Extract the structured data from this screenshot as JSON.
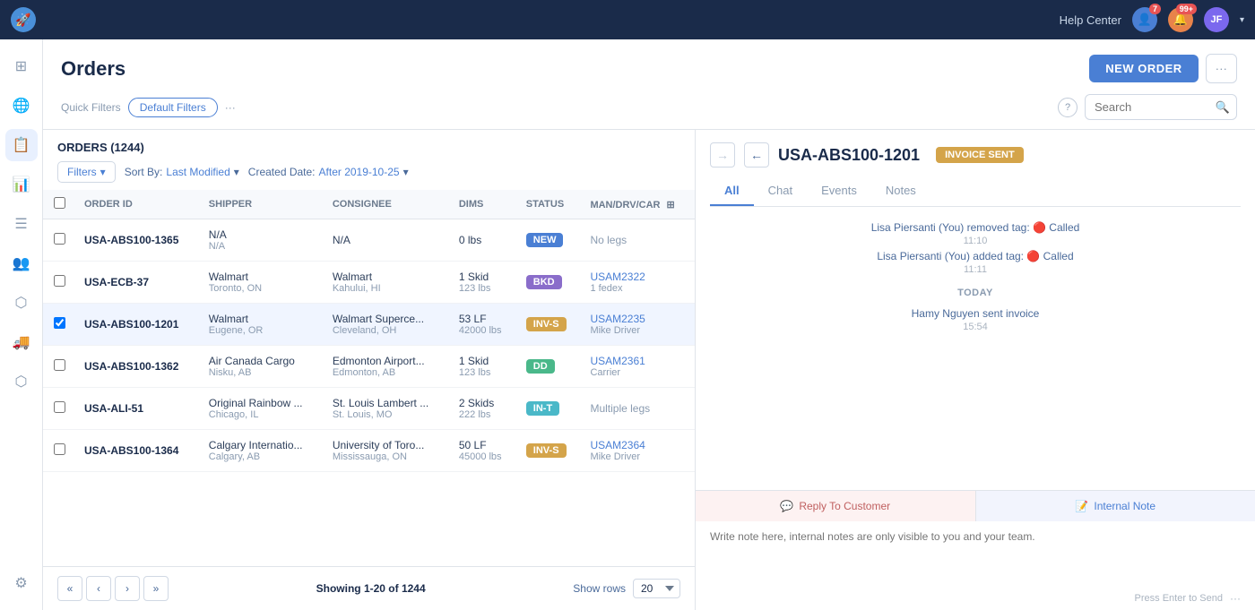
{
  "topNav": {
    "logoIcon": "🚀",
    "helpCenter": "Help Center",
    "notificationBadge1": "7",
    "notificationBadge2": "99+",
    "avatarText": "JF"
  },
  "sidebar": {
    "icons": [
      {
        "name": "home-icon",
        "symbol": "⊞",
        "active": false
      },
      {
        "name": "globe-icon",
        "symbol": "🌐",
        "active": false
      },
      {
        "name": "orders-icon",
        "symbol": "📋",
        "active": true
      },
      {
        "name": "chart-icon",
        "symbol": "📊",
        "active": false
      },
      {
        "name": "list-icon",
        "symbol": "☰",
        "active": false
      },
      {
        "name": "contacts-icon",
        "symbol": "👥",
        "active": false
      },
      {
        "name": "routes-icon",
        "symbol": "⬡",
        "active": false
      },
      {
        "name": "truck-icon",
        "symbol": "🚚",
        "active": false
      },
      {
        "name": "network-icon",
        "symbol": "⬡",
        "active": false
      },
      {
        "name": "settings-icon",
        "symbol": "⚙",
        "active": false
      }
    ]
  },
  "pageHeader": {
    "title": "Orders",
    "newOrderLabel": "NEW ORDER",
    "moreLabel": "···",
    "quickFiltersLabel": "Quick Filters",
    "defaultFiltersLabel": "Default Filters",
    "moreFiltersLabel": "···"
  },
  "searchBar": {
    "placeholder": "Search"
  },
  "ordersPanel": {
    "title": "ORDERS (1244)",
    "filtersLabel": "Filters",
    "sortLabel": "Sort By:",
    "sortValue": "Last Modified",
    "createdLabel": "Created Date:",
    "createdValue": "After 2019-10-25",
    "columns": [
      "ORDER ID",
      "SHIPPER",
      "CONSIGNEE",
      "DIMS",
      "STATUS",
      "MAN/DRV/CAR"
    ],
    "orders": [
      {
        "id": "USA-ABS100-1365",
        "shipperName": "N/A",
        "shipperSub": "N/A",
        "consigneeName": "N/A",
        "consigneeSub": "",
        "dims": "0 lbs",
        "dimsSub": "",
        "statusCode": "NEW",
        "statusClass": "status-new",
        "mandrv": "No legs",
        "mandrvSub": "",
        "mandrvLink": false
      },
      {
        "id": "USA-ECB-37",
        "shipperName": "Walmart",
        "shipperSub": "Toronto, ON",
        "consigneeName": "Walmart",
        "consigneeSub": "Kahului, HI",
        "dims": "1 Skid",
        "dimsSub": "123 lbs",
        "statusCode": "BKD",
        "statusClass": "status-bkd",
        "mandrv": "USAM2322",
        "mandrvSub": "1 fedex",
        "mandrvLink": true
      },
      {
        "id": "USA-ABS100-1201",
        "shipperName": "Walmart",
        "shipperSub": "Eugene, OR",
        "consigneeName": "Walmart Superce...",
        "consigneeSub": "Cleveland, OH",
        "dims": "53 LF",
        "dimsSub": "42000 lbs",
        "statusCode": "INV-S",
        "statusClass": "status-invs",
        "mandrv": "USAM2235",
        "mandrvSub": "Mike Driver",
        "mandrvLink": true,
        "selected": true
      },
      {
        "id": "USA-ABS100-1362",
        "shipperName": "Air Canada Cargo",
        "shipperSub": "Nisku, AB",
        "consigneeName": "Edmonton Airport...",
        "consigneeSub": "Edmonton, AB",
        "dims": "1 Skid",
        "dimsSub": "123 lbs",
        "statusCode": "DD",
        "statusClass": "status-dd",
        "mandrv": "USAM2361",
        "mandrvSub": "Carrier",
        "mandrvLink": true
      },
      {
        "id": "USA-ALI-51",
        "shipperName": "Original Rainbow ...",
        "shipperSub": "Chicago, IL",
        "consigneeName": "St. Louis Lambert ...",
        "consigneeSub": "St. Louis, MO",
        "dims": "2 Skids",
        "dimsSub": "222 lbs",
        "statusCode": "IN-T",
        "statusClass": "status-int",
        "mandrv": "Multiple legs",
        "mandrvSub": "",
        "mandrvLink": false
      },
      {
        "id": "USA-ABS100-1364",
        "shipperName": "Calgary Internatio...",
        "shipperSub": "Calgary, AB",
        "consigneeName": "University of Toro...",
        "consigneeSub": "Mississauga, ON",
        "dims": "50 LF",
        "dimsSub": "45000 lbs",
        "statusCode": "INV-S",
        "statusClass": "status-invs",
        "mandrv": "USAM2364",
        "mandrvSub": "Mike Driver",
        "mandrvLink": true
      }
    ],
    "footer": {
      "showingText": "Showing 1-20 of 1244",
      "showRowsLabel": "Show rows",
      "rowsValue": "20"
    }
  },
  "detailPanel": {
    "orderRef": "USA-ABS100-1201",
    "invoiceBadge": "INVOICE SENT",
    "tabs": [
      "All",
      "Chat",
      "Events",
      "Notes"
    ],
    "activeTab": "All",
    "activity": [
      {
        "type": "event",
        "text": "Lisa Piersanti (You) removed tag: 🔴 Called",
        "time": "11:10"
      },
      {
        "type": "event",
        "text": "Lisa Piersanti (You) added tag: 🔴 Called",
        "time": "11:11"
      },
      {
        "type": "dayLabel",
        "text": "TODAY"
      },
      {
        "type": "event",
        "text": "Hamy Nguyen sent invoice",
        "time": "15:54"
      }
    ],
    "replyCustomerLabel": "Reply To Customer",
    "internalNoteLabel": "Internal Note",
    "notePlaceholder": "Write note here, internal notes are only visible to you and your team.",
    "pressEnterText": "Press Enter to Send",
    "moreLabel": "···"
  }
}
